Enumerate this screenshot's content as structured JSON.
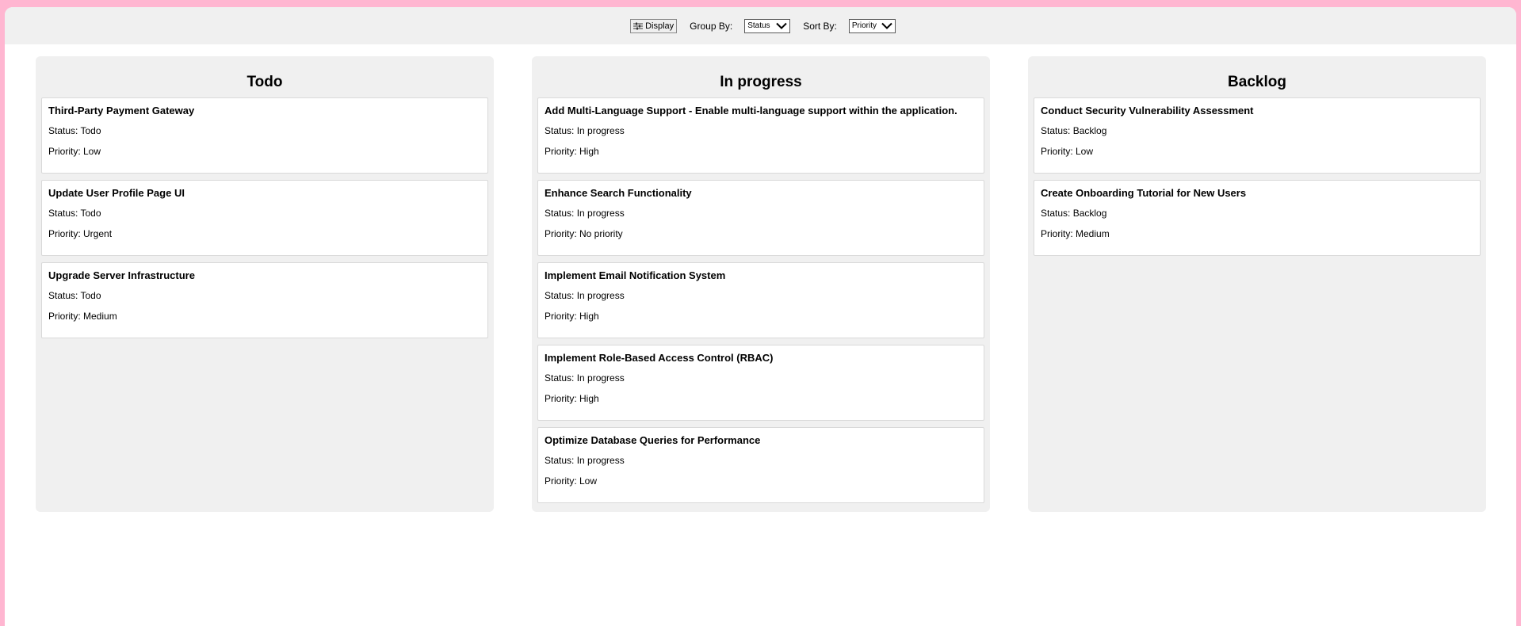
{
  "toolbar": {
    "display_label": "Display",
    "group_by_label": "Group By:",
    "group_by_value": "Status",
    "sort_by_label": "Sort By:",
    "sort_by_value": "Priority"
  },
  "columns": [
    {
      "title": "Todo",
      "cards": [
        {
          "title": "Third-Party Payment Gateway",
          "status": "Status: Todo",
          "priority": "Priority: Low"
        },
        {
          "title": "Update User Profile Page UI",
          "status": "Status: Todo",
          "priority": "Priority: Urgent"
        },
        {
          "title": "Upgrade Server Infrastructure",
          "status": "Status: Todo",
          "priority": "Priority: Medium"
        }
      ]
    },
    {
      "title": "In progress",
      "cards": [
        {
          "title": "Add Multi-Language Support - Enable multi-language support within the application.",
          "status": "Status: In progress",
          "priority": "Priority: High"
        },
        {
          "title": "Enhance Search Functionality",
          "status": "Status: In progress",
          "priority": "Priority: No priority"
        },
        {
          "title": "Implement Email Notification System",
          "status": "Status: In progress",
          "priority": "Priority: High"
        },
        {
          "title": "Implement Role-Based Access Control (RBAC)",
          "status": "Status: In progress",
          "priority": "Priority: High"
        },
        {
          "title": "Optimize Database Queries for Performance",
          "status": "Status: In progress",
          "priority": "Priority: Low"
        }
      ]
    },
    {
      "title": "Backlog",
      "cards": [
        {
          "title": "Conduct Security Vulnerability Assessment",
          "status": "Status: Backlog",
          "priority": "Priority: Low"
        },
        {
          "title": "Create Onboarding Tutorial for New Users",
          "status": "Status: Backlog",
          "priority": "Priority: Medium"
        }
      ]
    }
  ]
}
